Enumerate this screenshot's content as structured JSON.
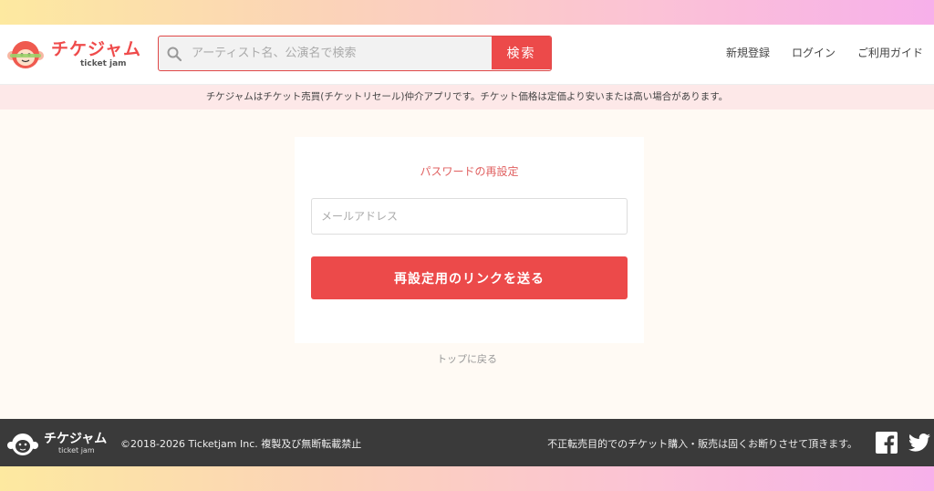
{
  "header": {
    "logo_text": "チケジャム",
    "logo_sub": "ticket jam",
    "search": {
      "placeholder": "アーティスト名、公演名で検索",
      "button_label": "検索"
    },
    "nav": {
      "register": "新規登録",
      "login": "ログイン",
      "guide": "ご利用ガイド"
    }
  },
  "notice": "チケジャムはチケット売買(チケットリセール)仲介アプリです。チケット価格は定価より安いまたは高い場合があります。",
  "reset_form": {
    "title": "パスワードの再設定",
    "email_placeholder": "メールアドレス",
    "email_value": "",
    "submit_label": "再設定用のリンクを送る"
  },
  "back_link": "トップに戻る",
  "footer": {
    "logo_text": "チケジャム",
    "logo_sub": "ticket jam",
    "copyright": "©2018-2026 Ticketjam Inc. 複製及び無断転載禁止",
    "notice": "不正転売目的でのチケット購入・販売は固くお断りさせて頂きます。"
  },
  "colors": {
    "accent": "#ec4a4a",
    "notice_bg": "#fde8e8",
    "footer_bg": "#3a3a3a",
    "page_bg": "#fffaf4"
  },
  "icons": [
    "monkey-logo-icon",
    "search-icon",
    "facebook-icon",
    "twitter-icon"
  ]
}
